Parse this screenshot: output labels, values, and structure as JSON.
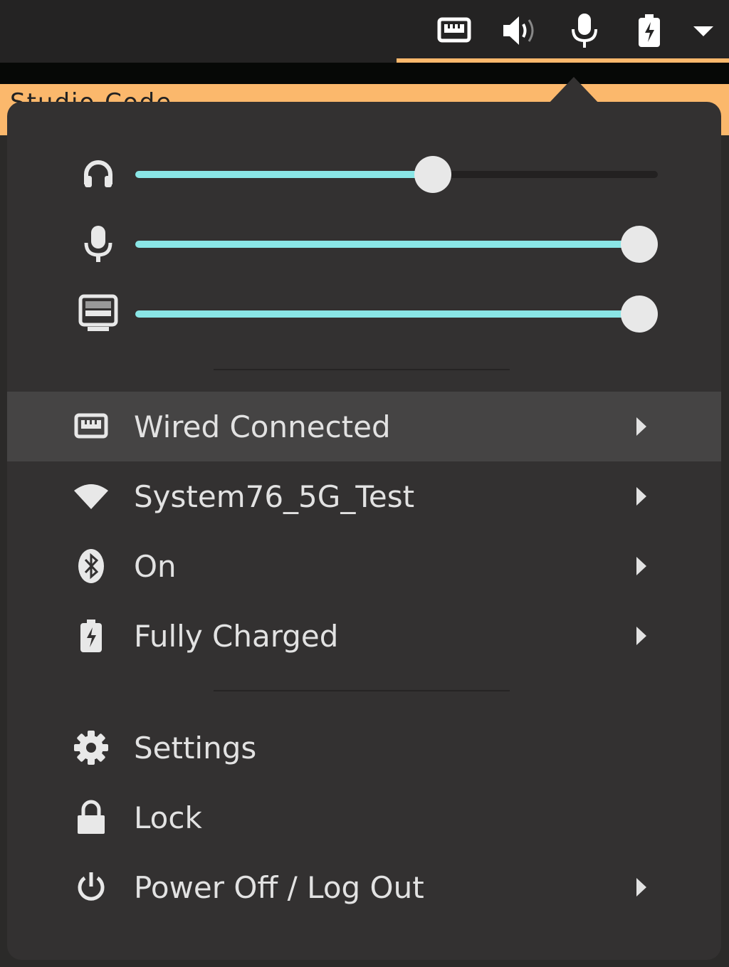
{
  "background_window": {
    "title": "Studio Code"
  },
  "colors": {
    "accent": "#fbb86c",
    "slider": "#8ae6e6",
    "popup_bg": "#333131"
  },
  "tray": [
    {
      "icon": "ethernet-icon"
    },
    {
      "icon": "volume-icon"
    },
    {
      "icon": "microphone-icon"
    },
    {
      "icon": "battery-charging-icon"
    },
    {
      "icon": "menu-dropdown-icon"
    }
  ],
  "sliders": [
    {
      "icon": "headphones-icon",
      "value": 0.59
    },
    {
      "icon": "microphone-icon",
      "value": 1.0
    },
    {
      "icon": "display-icon",
      "value": 1.0
    }
  ],
  "menu": {
    "network": [
      {
        "label": "Wired Connected",
        "icon": "ethernet-icon",
        "submenu": true,
        "highlighted": true
      },
      {
        "label": "System76_5G_Test",
        "icon": "wifi-icon",
        "submenu": true
      },
      {
        "label": "On",
        "icon": "bluetooth-icon",
        "submenu": true
      },
      {
        "label": "Fully Charged",
        "icon": "battery-charging-icon",
        "submenu": true
      }
    ],
    "system": [
      {
        "label": "Settings",
        "icon": "gear-icon",
        "submenu": false
      },
      {
        "label": "Lock",
        "icon": "lock-icon",
        "submenu": false
      },
      {
        "label": "Power Off / Log Out",
        "icon": "power-icon",
        "submenu": true
      }
    ]
  }
}
